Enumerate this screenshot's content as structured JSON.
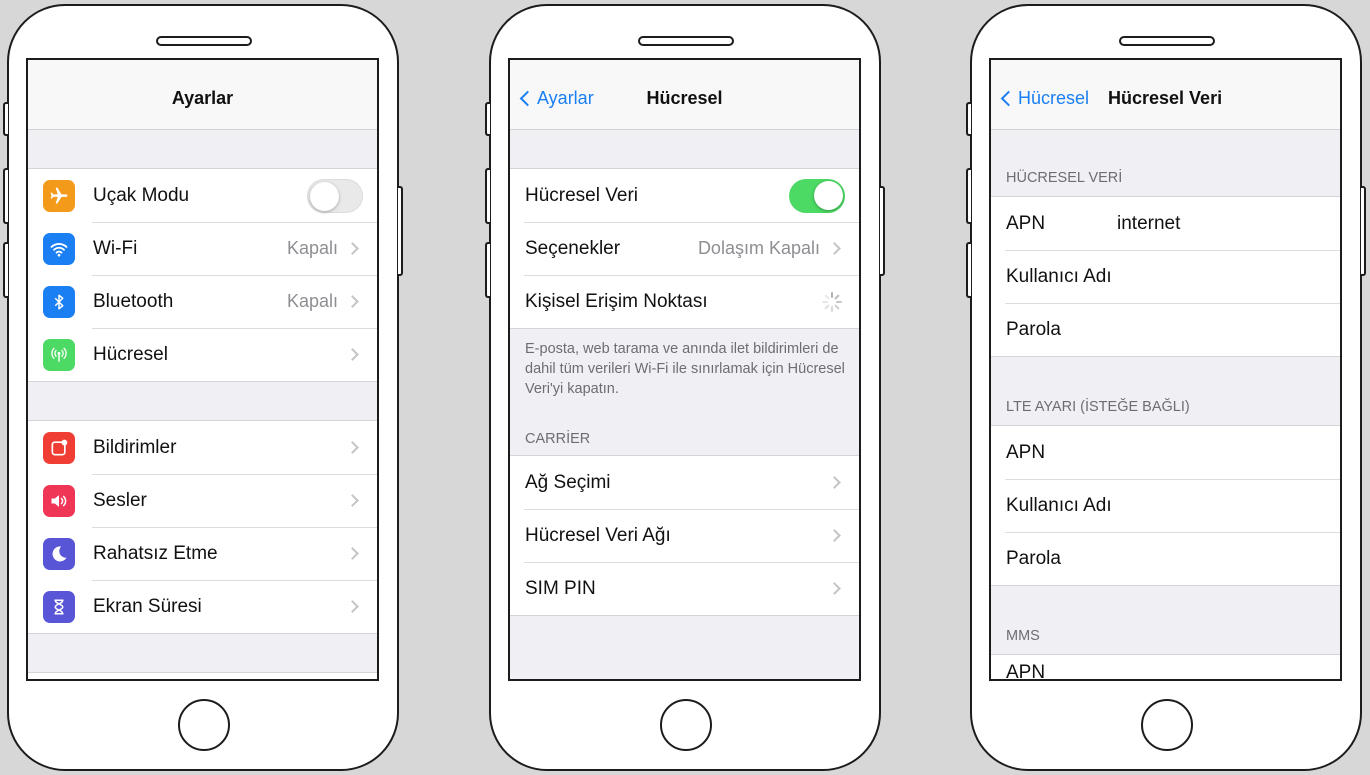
{
  "screen1": {
    "title": "Ayarlar",
    "group1": [
      {
        "label": "Uçak Modu",
        "icon": "airplane-icon",
        "color": "#f49a1a",
        "toggle": "off"
      },
      {
        "label": "Wi-Fi",
        "icon": "wifi-icon",
        "color": "#1a7ff2",
        "value": "Kapalı"
      },
      {
        "label": "Bluetooth",
        "icon": "bluetooth-icon",
        "color": "#1a7ff2",
        "value": "Kapalı"
      },
      {
        "label": "Hücresel",
        "icon": "cellular-icon",
        "color": "#4cd964"
      }
    ],
    "group2": [
      {
        "label": "Bildirimler",
        "icon": "notifications-icon",
        "color": "#f03e35"
      },
      {
        "label": "Sesler",
        "icon": "sounds-icon",
        "color": "#ef3656"
      },
      {
        "label": "Rahatsız Etme",
        "icon": "moon-icon",
        "color": "#5856d6"
      },
      {
        "label": "Ekran Süresi",
        "icon": "hourglass-icon",
        "color": "#5856d6"
      }
    ]
  },
  "screen2": {
    "back": "Ayarlar",
    "title": "Hücresel",
    "group1": [
      {
        "label": "Hücresel Veri",
        "toggle": "on"
      },
      {
        "label": "Seçenekler",
        "value": "Dolaşım Kapalı"
      },
      {
        "label": "Kişisel Erişim Noktası"
      }
    ],
    "note": "E-posta, web tarama ve anında ilet bildirimleri de dahil tüm verileri Wi-Fi ile sınırlamak için Hücresel Veri'yi kapatın.",
    "section": "CARRİER",
    "group2": [
      {
        "label": "Ağ Seçimi"
      },
      {
        "label": "Hücresel Veri Ağı"
      },
      {
        "label": "SIM PIN"
      }
    ]
  },
  "screen3": {
    "back": "Hücresel",
    "title": "Hücresel Veri",
    "section1": "HÜCRESEL VERİ",
    "group1": [
      {
        "label": "APN",
        "value": "internet"
      },
      {
        "label": "Kullanıcı Adı"
      },
      {
        "label": "Parola"
      }
    ],
    "section2": "LTE AYARI (İSTEĞE BAĞLI)",
    "group2": [
      {
        "label": "APN"
      },
      {
        "label": "Kullanıcı Adı"
      },
      {
        "label": "Parola"
      }
    ],
    "section3": "MMS",
    "group3": [
      {
        "label": "APN"
      }
    ]
  },
  "colors": {
    "accent": "#1a7ff2",
    "toggle_on": "#4cd964",
    "background": "#efeff4"
  }
}
